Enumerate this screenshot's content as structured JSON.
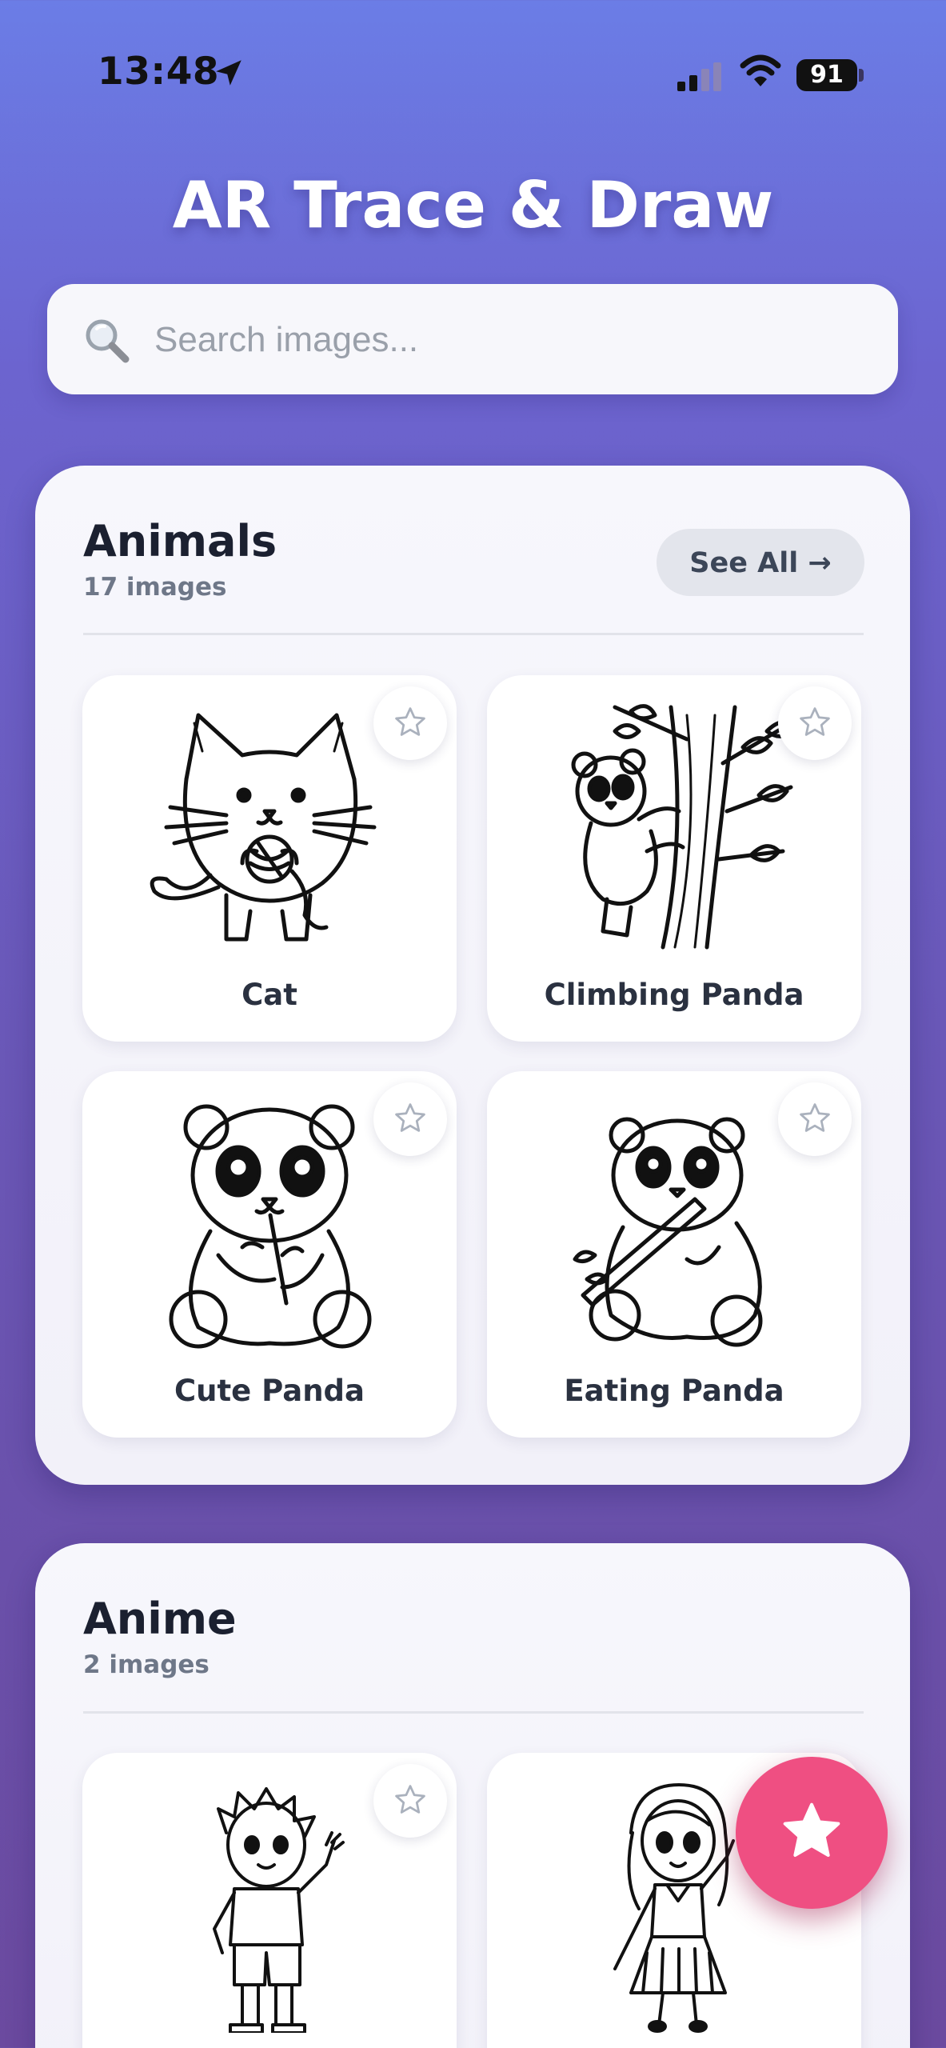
{
  "status_bar": {
    "time": "13:48",
    "battery": "91",
    "icons": [
      "location-arrow-icon",
      "cellular-signal-icon",
      "wifi-icon",
      "battery-icon"
    ]
  },
  "header": {
    "title": "AR Trace & Draw"
  },
  "search": {
    "placeholder": "Search images...",
    "value": "",
    "icon": "search-icon"
  },
  "sections": [
    {
      "title": "Animals",
      "count": "17 images",
      "see_all": "See All →",
      "items": [
        {
          "label": "Cat",
          "icon": "cat-drawing"
        },
        {
          "label": "Climbing Panda",
          "icon": "climbing-panda-drawing"
        },
        {
          "label": "Cute Panda",
          "icon": "cute-panda-drawing"
        },
        {
          "label": "Eating Panda",
          "icon": "eating-panda-drawing"
        }
      ]
    },
    {
      "title": "Anime",
      "count": "2 images",
      "items": [
        {
          "label": "",
          "icon": "anime-boy-drawing"
        },
        {
          "label": "",
          "icon": "anime-girl-drawing"
        }
      ]
    }
  ],
  "favorites_fab": {
    "icon": "star-icon"
  },
  "colors": {
    "background_top": "#6b7de6",
    "background_bottom": "#6b4a9f",
    "fab": "#ef4f82",
    "card": "#f6f6fb"
  }
}
